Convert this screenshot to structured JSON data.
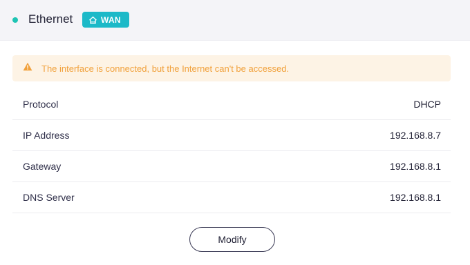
{
  "header": {
    "title": "Ethernet",
    "status": "connected",
    "status_color": "#1ec4b4",
    "badge": {
      "icon": "router-icon",
      "label": "WAN",
      "color": "#1cb9c8"
    }
  },
  "alert": {
    "icon": "warning-icon",
    "message": "The interface is connected, but the Internet can't be accessed.",
    "color": "#f1a03a"
  },
  "info": [
    {
      "label": "Protocol",
      "value": "DHCP"
    },
    {
      "label": "IP Address",
      "value": "192.168.8.7"
    },
    {
      "label": "Gateway",
      "value": "192.168.8.1"
    },
    {
      "label": "DNS Server",
      "value": "192.168.8.1"
    }
  ],
  "actions": {
    "modify_label": "Modify"
  }
}
